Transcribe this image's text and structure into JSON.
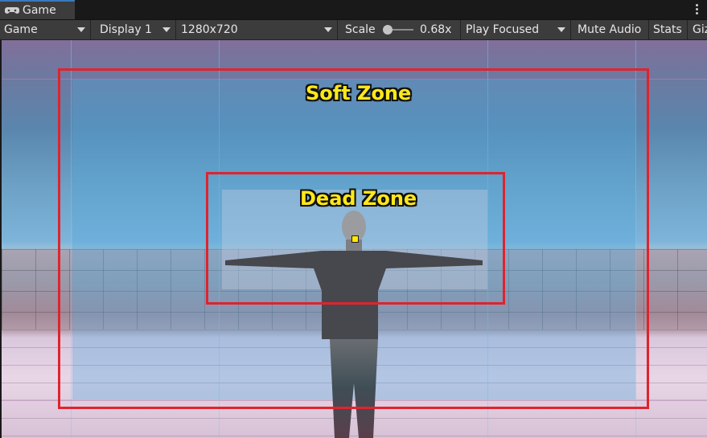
{
  "window": {
    "tab_label": "Game",
    "tab_icon": "gamepad-icon",
    "menu_icon": "kebab-menu-icon"
  },
  "toolbar": {
    "view_dropdown": "Game",
    "display_dropdown": "Display 1",
    "resolution_dropdown": "1280x720",
    "scale_label": "Scale",
    "scale_value": "0.68x",
    "play_mode_dropdown": "Play Focused",
    "mute_audio_label": "Mute Audio",
    "stats_label": "Stats",
    "gizmos_label": "Giz"
  },
  "viewport": {
    "soft_zone_label": "Soft Zone",
    "dead_zone_label": "Dead Zone",
    "zone_outline_color": "#e0232e",
    "label_color": "#ffe81a",
    "target_color": "#ffea00"
  }
}
